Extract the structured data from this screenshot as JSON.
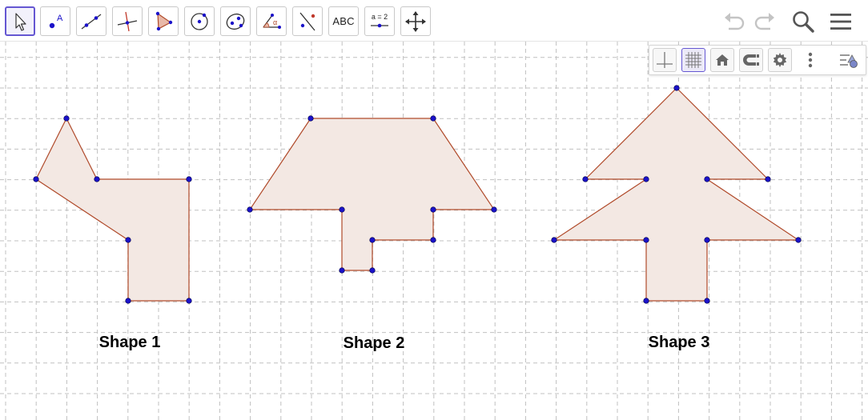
{
  "toolbar": {
    "tools": [
      {
        "name": "move-tool",
        "icon": "arrow-cursor-icon",
        "selected": true
      },
      {
        "name": "point-tool",
        "icon": "point-icon",
        "label": "A"
      },
      {
        "name": "line-tool",
        "icon": "line-icon"
      },
      {
        "name": "perpendicular-tool",
        "icon": "perpendicular-line-icon"
      },
      {
        "name": "polygon-tool",
        "icon": "polygon-icon"
      },
      {
        "name": "circle-tool",
        "icon": "circle-center-icon"
      },
      {
        "name": "ellipse-tool",
        "icon": "ellipse-icon"
      },
      {
        "name": "angle-tool",
        "icon": "angle-icon",
        "label": "α"
      },
      {
        "name": "reflect-tool",
        "icon": "reflect-icon"
      },
      {
        "name": "text-tool",
        "icon": "text-icon",
        "label": "ABC"
      },
      {
        "name": "slider-tool",
        "icon": "slider-icon",
        "label": "a = 2"
      },
      {
        "name": "move-view-tool",
        "icon": "move-graphics-icon"
      }
    ],
    "actions": {
      "undo": "undo-icon",
      "redo": "redo-icon",
      "search": "search-icon",
      "menu": "hamburger-menu-icon"
    }
  },
  "style_bar": {
    "buttons": [
      {
        "name": "axes-toggle",
        "icon": "axes-icon"
      },
      {
        "name": "grid-toggle",
        "icon": "grid-icon",
        "active": true
      },
      {
        "name": "standard-view",
        "icon": "home-icon"
      },
      {
        "name": "point-capturing",
        "icon": "magnet-capture-icon"
      },
      {
        "name": "graphics-settings",
        "icon": "gear-icon"
      },
      {
        "name": "more-options",
        "icon": "vertical-dots-icon"
      },
      {
        "name": "toggle-style-bar",
        "icon": "style-bar-icon"
      }
    ]
  },
  "canvas": {
    "colors": {
      "grid": "#c0c0c0",
      "polygon_fill": "#f3e8e3",
      "polygon_stroke": "#b04a2a",
      "point": "#1b12c9"
    },
    "shapes": [
      {
        "label": "Shape 1"
      },
      {
        "label": "Shape 2"
      },
      {
        "label": "Shape 3"
      }
    ]
  }
}
